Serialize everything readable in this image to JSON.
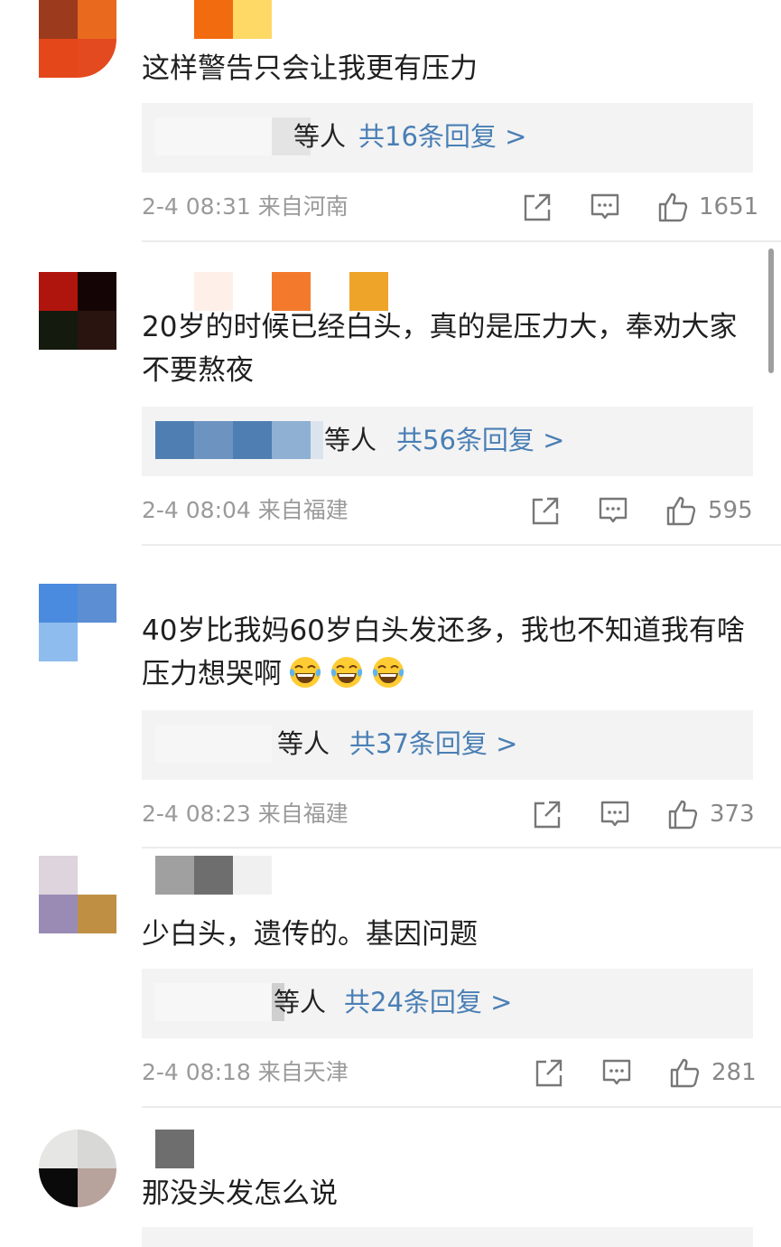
{
  "comments": [
    {
      "text": "这样警告只会让我更有压力",
      "reply_who": "等人",
      "reply_count": "共16条回复 >",
      "time": "2-4 08:31",
      "location": "来自河南",
      "likes": "1651"
    },
    {
      "text": "20岁的时候已经白头，真的是压力大，奉劝大家不要熬夜",
      "reply_who": "等人",
      "reply_count": "共56条回复 >",
      "time": "2-4 08:04",
      "location": "来自福建",
      "likes": "595"
    },
    {
      "text": "40岁比我妈60岁白头发还多，我也不知道我有啥压力想哭啊",
      "reply_who": "等人",
      "reply_count": "共37条回复 >",
      "time": "2-4 08:23",
      "location": "来自福建",
      "likes": "373"
    },
    {
      "text": "少白头，遗传的。基因问题",
      "reply_who": "等人",
      "reply_count": "共24条回复 >",
      "time": "2-4 08:18",
      "location": "来自天津",
      "likes": "281"
    },
    {
      "text": "那没头发怎么说"
    }
  ],
  "icons": {
    "share": "share-icon",
    "comment": "comment-icon",
    "like": "thumbs-up-icon",
    "emoji": "tears-of-joy-emoji"
  },
  "colors": {
    "link": "#4a7fb5",
    "meta": "#9a9a9a",
    "reply_bg": "#f3f3f3"
  }
}
